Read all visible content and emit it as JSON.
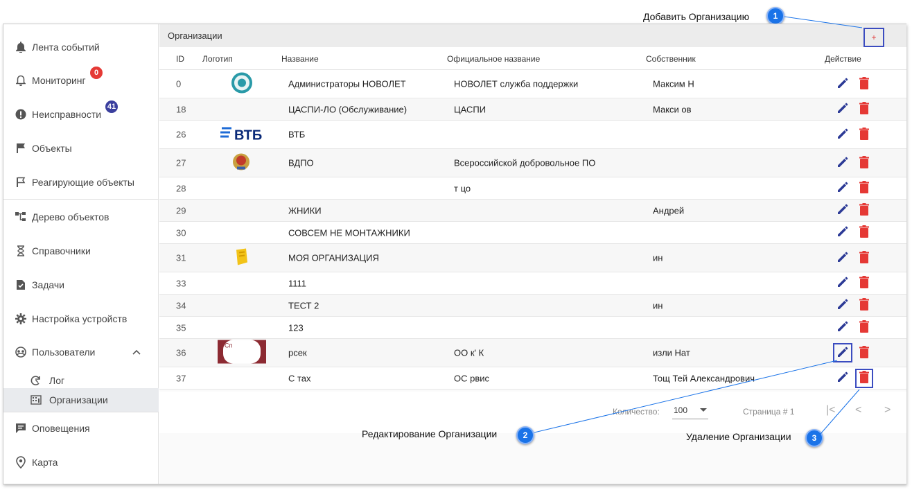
{
  "sidebar": {
    "items": [
      {
        "label": "Лента событий",
        "icon": "bell-filled-icon"
      },
      {
        "label": "Мониторинг",
        "icon": "bell-outline-icon",
        "badge": "0"
      },
      {
        "label": "Неисправности",
        "icon": "alert-circle-icon",
        "badge": "41"
      },
      {
        "label": "Объекты",
        "icon": "flag-icon"
      },
      {
        "label": "Реагирующие объекты",
        "icon": "flag-outline-icon"
      },
      {
        "label": "Дерево объектов",
        "icon": "tree-icon"
      },
      {
        "label": "Справочники",
        "icon": "hourglass-icon"
      },
      {
        "label": "Задачи",
        "icon": "task-icon"
      },
      {
        "label": "Настройка устройств",
        "icon": "gear-icon"
      },
      {
        "label": "Пользователи",
        "icon": "users-icon"
      },
      {
        "label": "Лог",
        "icon": "log-icon"
      },
      {
        "label": "Организации",
        "icon": "building-icon"
      },
      {
        "label": "Оповещения",
        "icon": "message-icon"
      },
      {
        "label": "Карта",
        "icon": "map-pin-icon"
      }
    ]
  },
  "panel": {
    "title": "Организации",
    "add_label": "+"
  },
  "table": {
    "headers": {
      "id": "ID",
      "logo": "Логотип",
      "name": "Название",
      "official": "Официальное название",
      "owner": "Собственник",
      "action": "Действие"
    },
    "rows": [
      {
        "id": "0",
        "name": "Администраторы НОВОЛЕТ",
        "official": "НОВОЛЕТ служба поддержки",
        "owner": "Максим Н",
        "logo": "circle"
      },
      {
        "id": "18",
        "name": "ЦАСПИ-ЛО (Обслуживание)",
        "official": "ЦАСПИ",
        "owner": "Макси          ов",
        "logo": ""
      },
      {
        "id": "26",
        "name": "ВТБ",
        "official": "",
        "owner": "",
        "logo": "vtb"
      },
      {
        "id": "27",
        "name": "ВДПО",
        "official": "Всероссийской добровольное ПО",
        "owner": "",
        "logo": "emblem"
      },
      {
        "id": "28",
        "name": "",
        "official": "т         цо",
        "owner": "",
        "logo": ""
      },
      {
        "id": "29",
        "name": "   ЖНИКИ",
        "official": "",
        "owner": "Андрей",
        "logo": ""
      },
      {
        "id": "30",
        "name": "СОВСЕМ НЕ МОНТАЖНИКИ",
        "official": "",
        "owner": "",
        "logo": ""
      },
      {
        "id": "31",
        "name": "МОЯ ОРГАНИЗАЦИЯ",
        "official": "",
        "owner": "          ин",
        "logo": "yellow"
      },
      {
        "id": "33",
        "name": "1111",
        "official": "",
        "owner": "",
        "logo": ""
      },
      {
        "id": "34",
        "name": "ТЕСТ 2",
        "official": "",
        "owner": "          ин",
        "logo": ""
      },
      {
        "id": "35",
        "name": "123",
        "official": "",
        "owner": "",
        "logo": ""
      },
      {
        "id": "36",
        "name": "         рсек",
        "official": "ОО         к' К",
        "owner": "     изли      Нат",
        "logo": "red"
      },
      {
        "id": "37",
        "name": "С          тах",
        "official": "ОС            рвис",
        "owner": "Тощ        Тей Александрович",
        "logo": ""
      }
    ]
  },
  "pager": {
    "count_label": "Количество:",
    "count_value": "100",
    "page_label": "Страница # 1",
    "first": "|<",
    "prev": "<",
    "next": ">"
  },
  "callouts": [
    {
      "num": "1",
      "text": "Добавить Организацию"
    },
    {
      "num": "2",
      "text": "Редактирование Организации"
    },
    {
      "num": "3",
      "text": "Удаление Организации"
    }
  ],
  "colors": {
    "highlight": "#3b4cc0",
    "edit": "#2c3a96",
    "delete": "#e53935",
    "callout": "#1a73e8"
  }
}
